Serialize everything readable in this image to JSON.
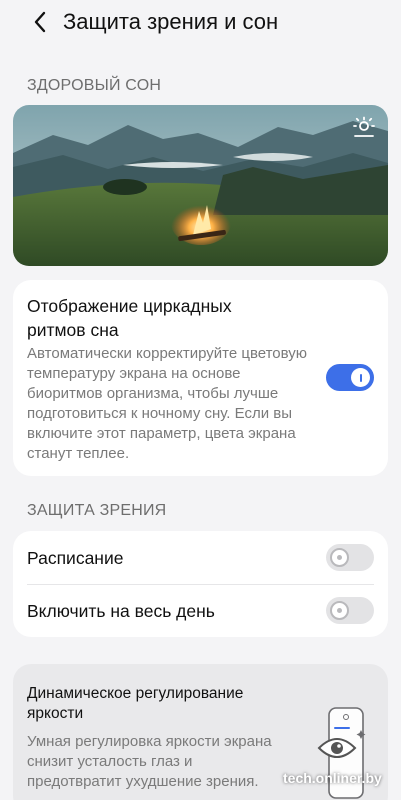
{
  "header": {
    "title": "Защита зрения и сон",
    "back_icon": "chevron-left-icon"
  },
  "sections": {
    "healthy_sleep": "ЗДОРОВЫЙ СОН",
    "eye_protection": "ЗАЩИТА ЗРЕНИЯ"
  },
  "hero": {
    "icon": "brightness-icon"
  },
  "circadian": {
    "title": "Отображение циркадных ритмов сна",
    "description": "Автоматически корректируйте цветовую температуру экрана на основе биоритмов организма, чтобы лучше подготовиться к ночному сну. Если вы включите этот параметр, цвета экрана станут теплее.",
    "enabled": true
  },
  "eye": {
    "schedule_label": "Расписание",
    "schedule_enabled": false,
    "all_day_label": "Включить на весь день",
    "all_day_enabled": false
  },
  "dynamic": {
    "title": "Динамическое регулирование яркости",
    "description": "Умная регулировка яркости экрана снизит усталость глаз и предотвратит ухудшение зрения."
  },
  "watermark": "tech.onliner.by",
  "colors": {
    "accent": "#3d6fe8",
    "background": "#f4f4f6",
    "card": "#ffffff"
  }
}
